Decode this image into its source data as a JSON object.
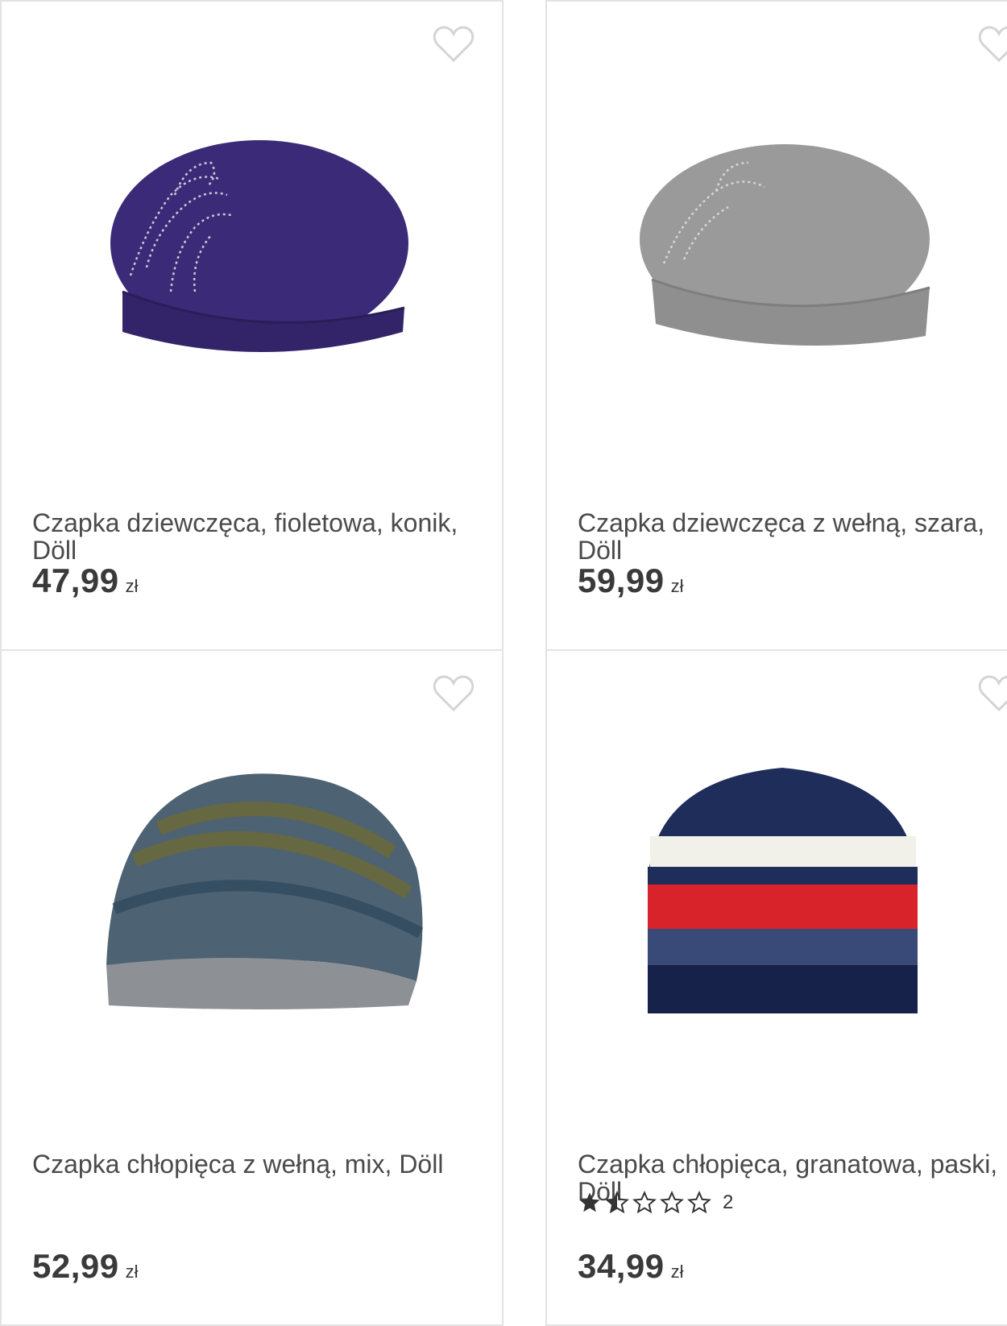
{
  "products": [
    {
      "name": "Czapka dziewczęca, fioletowa, konik, Döll",
      "price": "47,99",
      "currency": "zł",
      "hat_color": "#3b2a78"
    },
    {
      "name": "Czapka dziewczęca z wełną, szara, Döll",
      "price": "59,99",
      "currency": "zł",
      "hat_color": "#9a9a9a"
    },
    {
      "name": "Czapka chłopięca z wełną, mix, Döll",
      "price": "52,99",
      "currency": "zł",
      "hat_color": "#4d6272"
    },
    {
      "name": "Czapka chłopięca, granatowa, paski, Döll",
      "price": "34,99",
      "currency": "zł",
      "rating": 1.5,
      "rating_max": 5,
      "reviews": "2",
      "hat_color": "#1f2d5a"
    }
  ],
  "icons": {
    "favorite": "heart-outline-icon",
    "star_full": "star-filled-icon",
    "star_half": "star-half-icon",
    "star_empty": "star-outline-icon"
  },
  "colors": {
    "border": "#e3e3e3",
    "heart": "#d4d4d4",
    "text": "#4a4a4a"
  }
}
